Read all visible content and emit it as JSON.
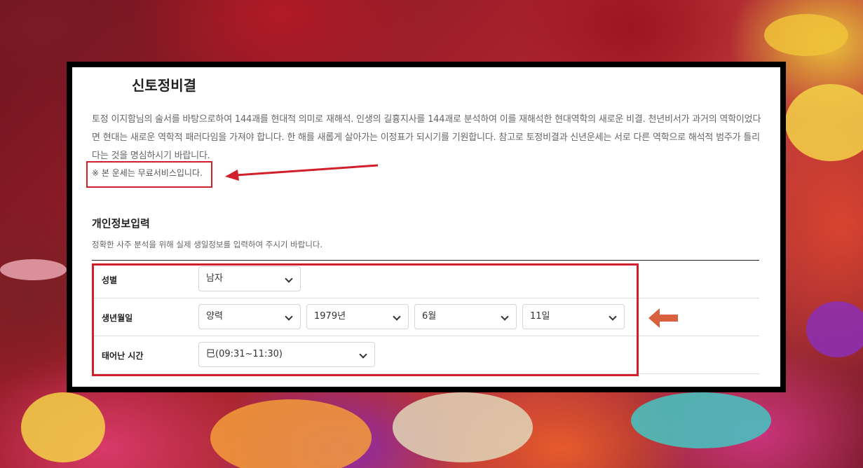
{
  "page": {
    "title": "신토정비결",
    "description": "토정 이지함님의 술서를 바탕으로하여 144괘를 현대적 의미로 재해석. 인생의 길흉지사를 144괘로 분석하여 이를 재해석한 현대역학의 새로운 비결. 천년비서가 과거의 역학이었다면 현대는 새로운 역학적 패러다임을 가져야 합니다. 한 해를 새롭게 살아가는 이정표가 되시기를 기원합니다. 참고로 토정비결과 신년운세는 서로 다른 역학으로 해석적 범주가 틀리다는 것을 명심하시기 바랍니다.",
    "notice": "※ 본 운세는 무료서비스입니다."
  },
  "form": {
    "title": "개인정보입력",
    "subtitle": "정확한 사주 분석을 위해 실제 생일정보를 입력하여 주시기 바랍니다.",
    "gender": {
      "label": "성별",
      "value": "남자"
    },
    "birth": {
      "label": "생년월일",
      "calendar": "양력",
      "year": "1979년",
      "month": "6월",
      "day": "11일"
    },
    "time": {
      "label": "태어난 시간",
      "value": "巳(09:31~11:30)"
    }
  },
  "colors": {
    "highlight": "#d0202b",
    "arrow_red": "#d0202b",
    "arrow_orange": "#d9603f"
  }
}
